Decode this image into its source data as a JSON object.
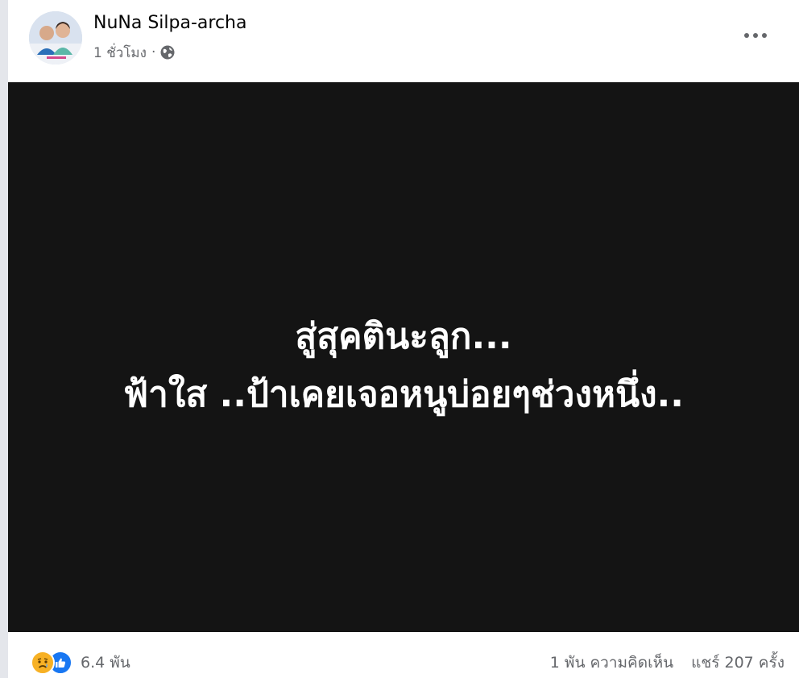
{
  "post": {
    "author": "NuNa Silpa-archa",
    "timestamp": "1 ชั่วโมง",
    "separator": "·",
    "privacy_icon": "globe-icon",
    "more_icon": "more-options-icon"
  },
  "media": {
    "line1": "สู่สุคตินะลูก...",
    "line2": "ฟ้าใส ..ป้าเคยเจอหนูบ่อยๆช่วงหนึ่ง.."
  },
  "footer": {
    "reactions_count": "6.4 พัน",
    "reaction_icons": [
      "sad-reaction-icon",
      "like-reaction-icon"
    ],
    "comments": "1 พัน ความคิดเห็น",
    "shares": "แชร์ 207 ครั้ง"
  },
  "colors": {
    "media_background": "#141414",
    "like_blue": "#1877f2",
    "sad_yellow": "#f7b125",
    "secondary_text": "#65676b"
  }
}
